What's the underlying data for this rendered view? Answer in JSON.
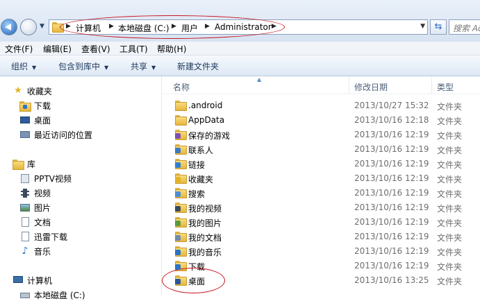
{
  "address_bar": {
    "crumbs": [
      "计算机",
      "本地磁盘 (C:)",
      "用户",
      "Administrator"
    ],
    "search_placeholder": "搜索 Adm"
  },
  "menu": [
    "文件(F)",
    "编辑(E)",
    "查看(V)",
    "工具(T)",
    "帮助(H)"
  ],
  "toolbar": {
    "organize": "组织",
    "include_in_library": "包含到库中",
    "share": "共享",
    "new_folder": "新建文件夹"
  },
  "nav_pane": {
    "favorites": {
      "header": "收藏夹",
      "items": [
        "下载",
        "桌面",
        "最近访问的位置"
      ]
    },
    "libraries": {
      "header": "库",
      "items": [
        "PPTV视频",
        "视频",
        "图片",
        "文档",
        "迅雷下载",
        "音乐"
      ]
    },
    "computer": {
      "header": "计算机",
      "items": [
        "本地磁盘 (C:)"
      ]
    }
  },
  "columns": {
    "name": "名称",
    "modified": "修改日期",
    "type": "类型"
  },
  "files": [
    {
      "name": ".android",
      "modified": "2013/10/27 15:32",
      "type": "文件夹",
      "icon": "folder-icon"
    },
    {
      "name": "AppData",
      "modified": "2013/10/16 12:18",
      "type": "文件夹",
      "icon": "folder-icon"
    },
    {
      "name": "保存的游戏",
      "modified": "2013/10/16 12:19",
      "type": "文件夹",
      "icon": "saved-games-folder-icon"
    },
    {
      "name": "联系人",
      "modified": "2013/10/16 12:19",
      "type": "文件夹",
      "icon": "contacts-folder-icon"
    },
    {
      "name": "链接",
      "modified": "2013/10/16 12:19",
      "type": "文件夹",
      "icon": "links-folder-icon"
    },
    {
      "name": "收藏夹",
      "modified": "2013/10/16 12:19",
      "type": "文件夹",
      "icon": "favorites-folder-icon"
    },
    {
      "name": "搜索",
      "modified": "2013/10/16 12:19",
      "type": "文件夹",
      "icon": "searches-folder-icon"
    },
    {
      "name": "我的视频",
      "modified": "2013/10/16 12:19",
      "type": "文件夹",
      "icon": "videos-folder-icon"
    },
    {
      "name": "我的图片",
      "modified": "2013/10/16 12:19",
      "type": "文件夹",
      "icon": "pictures-folder-icon"
    },
    {
      "name": "我的文档",
      "modified": "2013/10/16 12:19",
      "type": "文件夹",
      "icon": "documents-folder-icon"
    },
    {
      "name": "我的音乐",
      "modified": "2013/10/16 12:19",
      "type": "文件夹",
      "icon": "music-folder-icon"
    },
    {
      "name": "下载",
      "modified": "2013/10/16 12:19",
      "type": "文件夹",
      "icon": "downloads-folder-icon"
    },
    {
      "name": "桌面",
      "modified": "2013/10/16 13:25",
      "type": "文件夹",
      "icon": "desktop-folder-icon"
    }
  ]
}
